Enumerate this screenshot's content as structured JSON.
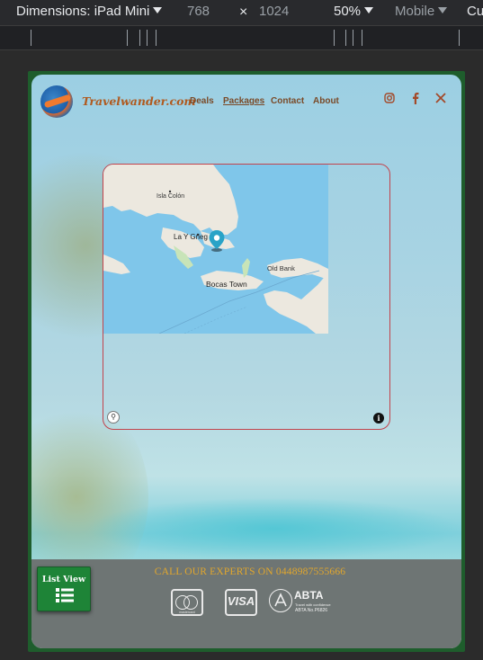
{
  "devtools": {
    "dimensions_label": "Dimensions: iPad Mini",
    "width": "768",
    "times": "×",
    "height": "1024",
    "zoom": "50%",
    "mode": "Mobile",
    "cut": "Cu"
  },
  "site": {
    "brand": "Travelwander.com",
    "nav": [
      "Deals",
      "Packages",
      "Contact",
      "About"
    ],
    "active_nav": "Packages",
    "social": [
      "instagram-icon",
      "facebook-icon",
      "x-icon"
    ]
  },
  "map": {
    "labels": {
      "isla_colon": "Isla Colón",
      "la_y_griega": "La Y Grieg",
      "old_bank": "Old Bank",
      "bocas_town": "Bocas Town"
    },
    "colors": {
      "water": "#7fc6ea",
      "land": "#ece8df",
      "marker": "#29a3c7",
      "border": "#c2434c"
    }
  },
  "footer": {
    "list_view_label": "List View",
    "experts_text": "CALL OUR EXPERTS ON 0448987555666",
    "payment_badges": [
      "mastercard",
      "VISA"
    ],
    "mastercard_text": "mastercard",
    "visa_text": "VISA",
    "abta_word": "ABTA",
    "abta_slogan": "Travel with confidence",
    "abta_number": "ABTA No.P6826"
  },
  "colors": {
    "footer_bg": "#6e7574",
    "list_view_bg": "#1e8437",
    "experts_text": "#e2a72c",
    "brand": "#b05a1f"
  }
}
